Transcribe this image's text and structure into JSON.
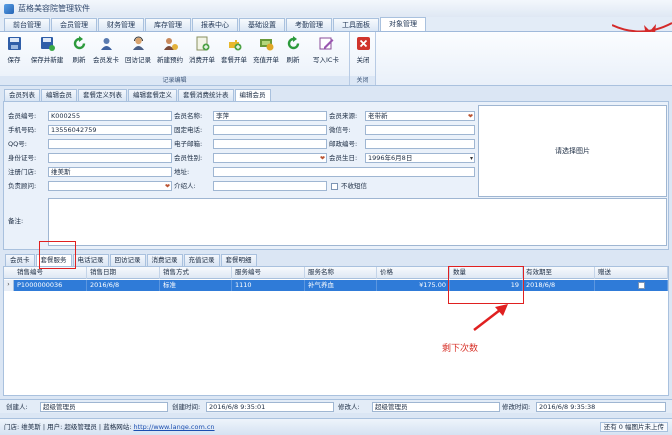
{
  "app": {
    "title": "蓝格美容院管理软件"
  },
  "menu": {
    "tabs": [
      "前台管理",
      "会员管理",
      "财务管理",
      "库存管理",
      "报表中心",
      "基础设置",
      "考勤管理",
      "工具面板",
      "对象管理"
    ]
  },
  "ribbon": {
    "buttons": [
      "保存",
      "保存并新建",
      "刷新",
      "会员发卡",
      "回访记录",
      "新建预约",
      "消费开单",
      "套餐开单",
      "充值开单",
      "刷新",
      "写入IC卡"
    ],
    "group_label": "记录编辑",
    "close_label": "关闭",
    "close_group_label": "关闭"
  },
  "page_tabs": [
    "会员列表",
    "编辑会员",
    "套餐定义列表",
    "编辑套餐定义",
    "套餐消费统计表",
    "编辑会员"
  ],
  "form": {
    "member_no_label": "会员编号:",
    "member_no": "K000255",
    "member_name_label": "会员名称:",
    "member_name": "李萍",
    "source_label": "会员来源:",
    "source": "老带新",
    "mobile_label": "手机号码:",
    "mobile": "13556042759",
    "phone_label": "固定电话:",
    "phone": "",
    "wechat_label": "微信号:",
    "wechat": "",
    "qq_label": "QQ号:",
    "qq": "",
    "email_label": "电子邮箱:",
    "email": "",
    "postcode_label": "邮政编号:",
    "postcode": "",
    "id_label": "身份证号:",
    "id": "",
    "gender_label": "会员性别:",
    "gender": "",
    "birthday_label": "会员生日:",
    "birthday": "1996年6月8日",
    "store_label": "注册门店:",
    "store": "维美斯",
    "address_label": "地址:",
    "address": "",
    "consultant_label": "负责顾问:",
    "consultant": "",
    "referrer_label": "介绍人:",
    "referrer": "",
    "no_sms_label": "不收短信",
    "photo_label": "请选择图片",
    "notes_label": "备注:"
  },
  "detail_tabs": [
    "会员卡",
    "套餐服务",
    "电话记录",
    "回访记录",
    "消费记录",
    "充值记录",
    "套餐明细"
  ],
  "grid": {
    "columns": [
      "销售编号",
      "销售日期",
      "销售方式",
      "服务编号",
      "服务名称",
      "价格",
      "数量",
      "有效期至",
      "赠送"
    ],
    "rows": [
      [
        "P1000000036",
        "2016/6/8",
        "标准",
        "1110",
        "补气养血",
        "¥175.00",
        "19",
        "2018/6/8",
        ""
      ]
    ]
  },
  "annotation": "剩下次数",
  "footer": {
    "creator_label": "创建人:",
    "creator": "超级管理员",
    "created_label": "创建时间:",
    "created": "2016/6/8 9:35:01",
    "modifier_label": "修改人:",
    "modifier": "超级管理员",
    "modified_label": "修改时间:",
    "modified": "2016/6/8 9:35:38"
  },
  "status": {
    "store": "门店: 维美斯",
    "user": "用户: 超级管理员",
    "site_label": "蓝格网站:",
    "site": "http://www.lange.com.cn",
    "right": "还有 0 幅图片未上传"
  },
  "colors": {
    "selection": "#2f7bd8",
    "highlight": "#e02020",
    "annotation": "#d8332a"
  }
}
